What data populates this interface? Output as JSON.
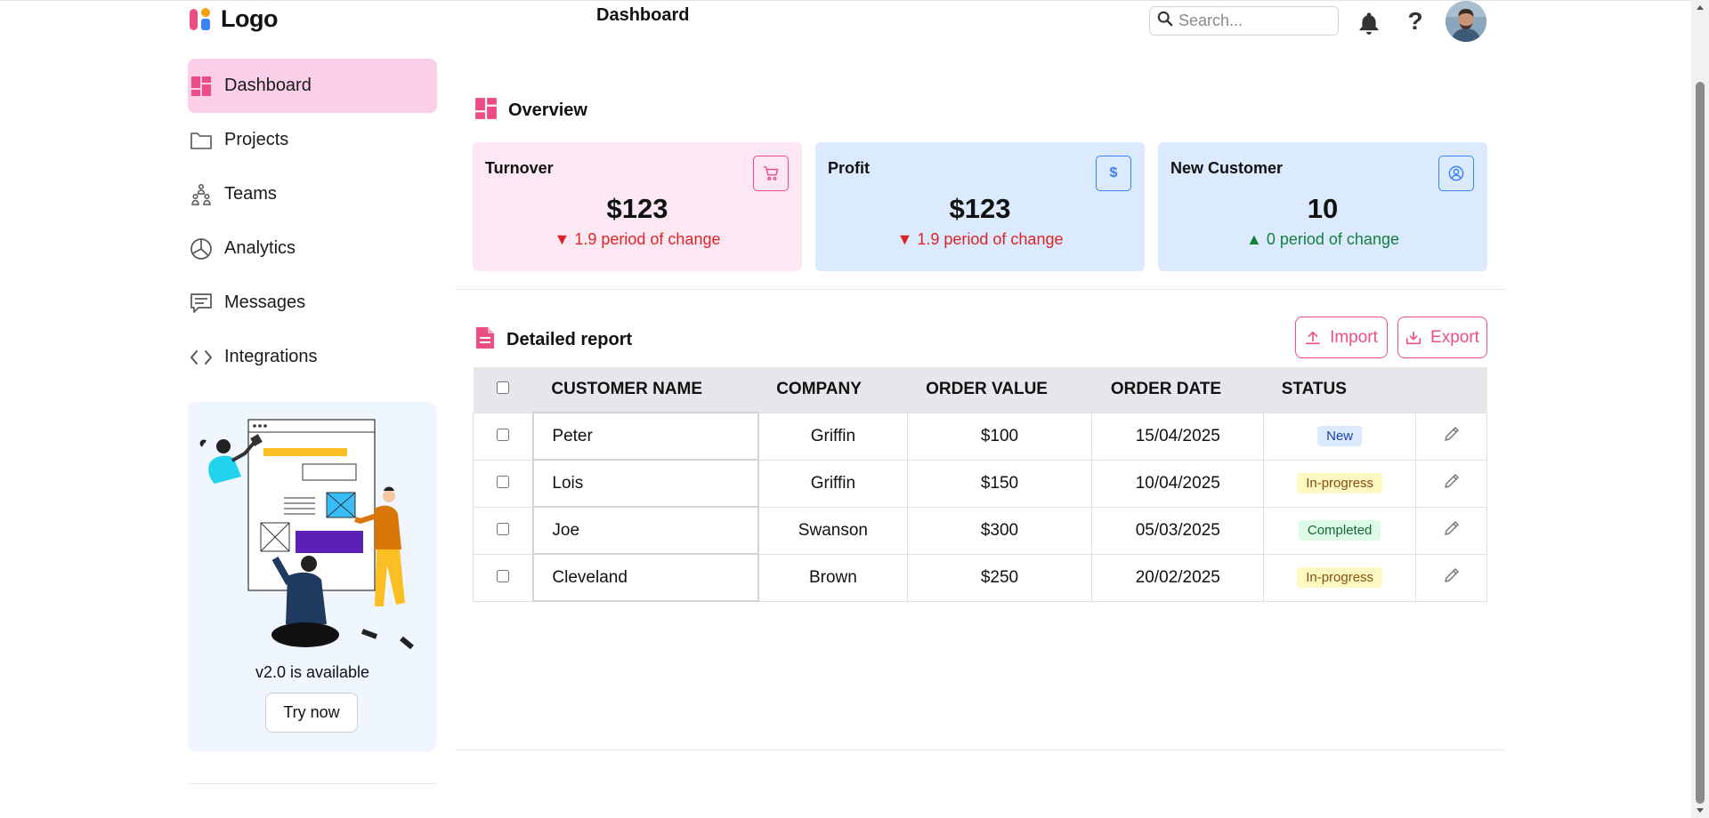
{
  "header": {
    "logo_text": "Logo",
    "page_title": "Dashboard",
    "search_placeholder": "Search...",
    "help_label": "?",
    "icons": {
      "bell": "bell-icon",
      "help": "question-icon",
      "avatar": "user-avatar"
    }
  },
  "sidebar": {
    "items": [
      {
        "label": "Dashboard",
        "icon": "dashboard-icon",
        "active": true
      },
      {
        "label": "Projects",
        "icon": "folder-icon",
        "active": false
      },
      {
        "label": "Teams",
        "icon": "teams-icon",
        "active": false
      },
      {
        "label": "Analytics",
        "icon": "pie-chart-icon",
        "active": false
      },
      {
        "label": "Messages",
        "icon": "message-icon",
        "active": false
      },
      {
        "label": "Integrations",
        "icon": "code-icon",
        "active": false
      }
    ],
    "promo": {
      "text": "v2.0 is available",
      "button": "Try now"
    }
  },
  "overview": {
    "title": "Overview",
    "cards": [
      {
        "title": "Turnover",
        "value": "$123",
        "arrow": "▼",
        "change": "1.9 period of change",
        "trend": "down",
        "icon": "cart-icon"
      },
      {
        "title": "Profit",
        "value": "$123",
        "arrow": "▼",
        "change": "1.9 period of change",
        "trend": "down",
        "icon": "dollar-icon"
      },
      {
        "title": "New Customer",
        "value": "10",
        "arrow": "▲",
        "change": "0 period of change",
        "trend": "up",
        "icon": "user-circle-icon"
      }
    ]
  },
  "report": {
    "title": "Detailed report",
    "import_label": "Import",
    "export_label": "Export",
    "columns": [
      "CUSTOMER NAME",
      "COMPANY",
      "ORDER VALUE",
      "ORDER DATE",
      "STATUS"
    ],
    "rows": [
      {
        "name": "Peter",
        "company": "Griffin",
        "value": "$100",
        "date": "15/04/2025",
        "status": "New"
      },
      {
        "name": "Lois",
        "company": "Griffin",
        "value": "$150",
        "date": "10/04/2025",
        "status": "In-progress"
      },
      {
        "name": "Joe",
        "company": "Swanson",
        "value": "$300",
        "date": "05/03/2025",
        "status": "Completed"
      },
      {
        "name": "Cleveland",
        "company": "Brown",
        "value": "$250",
        "date": "20/02/2025",
        "status": "In-progress"
      }
    ]
  },
  "colors": {
    "accent": "#ec4d87",
    "active_nav": "#fbcfe8",
    "card_pink": "#fce7f3",
    "card_blue": "#dbeafe",
    "down": "#dc2626",
    "up": "#15803d",
    "status_new_bg": "#dbeafe",
    "status_new_fg": "#1e40af",
    "status_progress_bg": "#fef9c3",
    "status_progress_fg": "#854d0e",
    "status_completed_bg": "#dcfce7",
    "status_completed_fg": "#166534"
  }
}
